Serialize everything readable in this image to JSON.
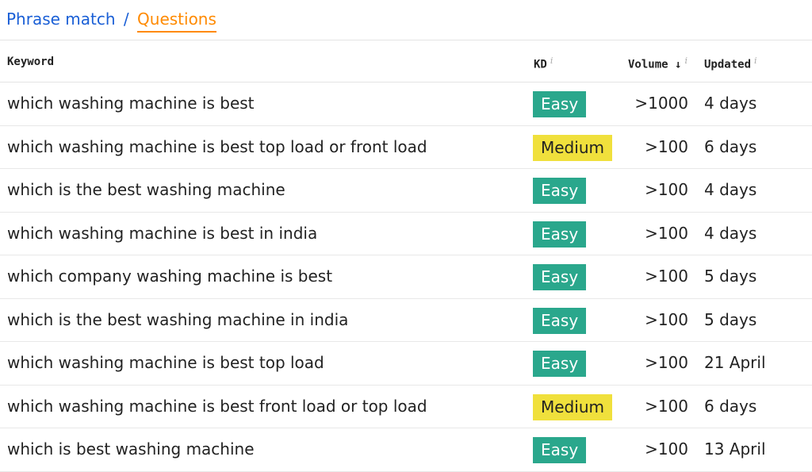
{
  "breadcrumb": {
    "parent": "Phrase match",
    "separator": "/",
    "current": "Questions"
  },
  "columns": {
    "keyword": "Keyword",
    "kd": "KD",
    "volume": "Volume",
    "sort_icon": "↓",
    "updated": "Updated",
    "info_icon": "i"
  },
  "colors": {
    "easy": "#2aa78c",
    "medium": "#f0e03c",
    "link": "#1a5fd6",
    "active": "#ff8a00"
  },
  "rows": [
    {
      "keyword": "which washing machine is best",
      "kd": "Easy",
      "volume": ">1000",
      "updated": "4 days"
    },
    {
      "keyword": "which washing machine is best top load or front load",
      "kd": "Medium",
      "volume": ">100",
      "updated": "6 days"
    },
    {
      "keyword": "which is the best washing machine",
      "kd": "Easy",
      "volume": ">100",
      "updated": "4 days"
    },
    {
      "keyword": "which washing machine is best in india",
      "kd": "Easy",
      "volume": ">100",
      "updated": "4 days"
    },
    {
      "keyword": "which company washing machine is best",
      "kd": "Easy",
      "volume": ">100",
      "updated": "5 days"
    },
    {
      "keyword": "which is the best washing machine in india",
      "kd": "Easy",
      "volume": ">100",
      "updated": "5 days"
    },
    {
      "keyword": "which washing machine is best top load",
      "kd": "Easy",
      "volume": ">100",
      "updated": "21 April"
    },
    {
      "keyword": "which washing machine is best front load or top load",
      "kd": "Medium",
      "volume": ">100",
      "updated": "6 days"
    },
    {
      "keyword": "which is best washing machine",
      "kd": "Easy",
      "volume": ">100",
      "updated": "13 April"
    }
  ]
}
